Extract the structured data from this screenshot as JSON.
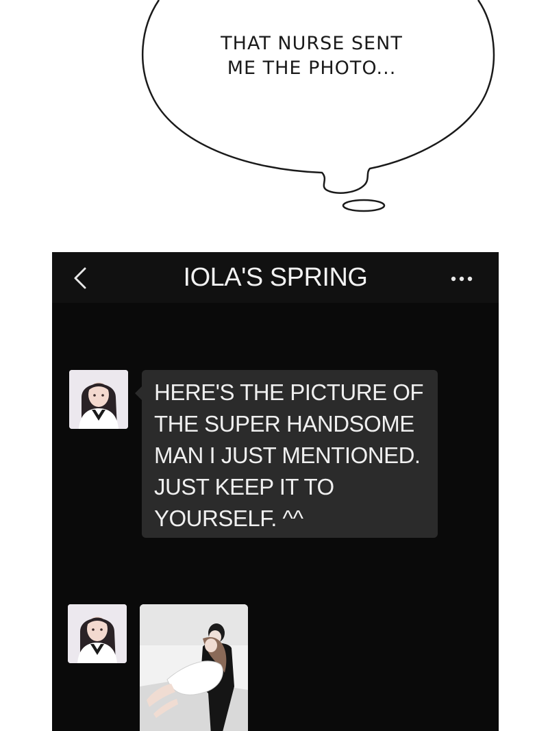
{
  "speech_bubble": {
    "lines": [
      "THAT NURSE SENT",
      "ME THE PHOTO..."
    ]
  },
  "chat": {
    "title": "IOLA'S SPRING",
    "back_icon": "chevron-left-icon",
    "more_icon": "more-dots-icon",
    "messages": [
      {
        "type": "text",
        "lines": [
          "HERE'S THE PICTURE OF",
          "THE SUPER HANDSOME",
          "MAN I JUST MENTIONED.",
          "JUST KEEP IT TO",
          "YOURSELF. ^^"
        ]
      },
      {
        "type": "image"
      }
    ]
  },
  "colors": {
    "screen_bg": "#0a0a0a",
    "topbar_bg": "#111111",
    "bubble_bg": "#2b2b2b",
    "text_light": "#f0f0f0"
  }
}
